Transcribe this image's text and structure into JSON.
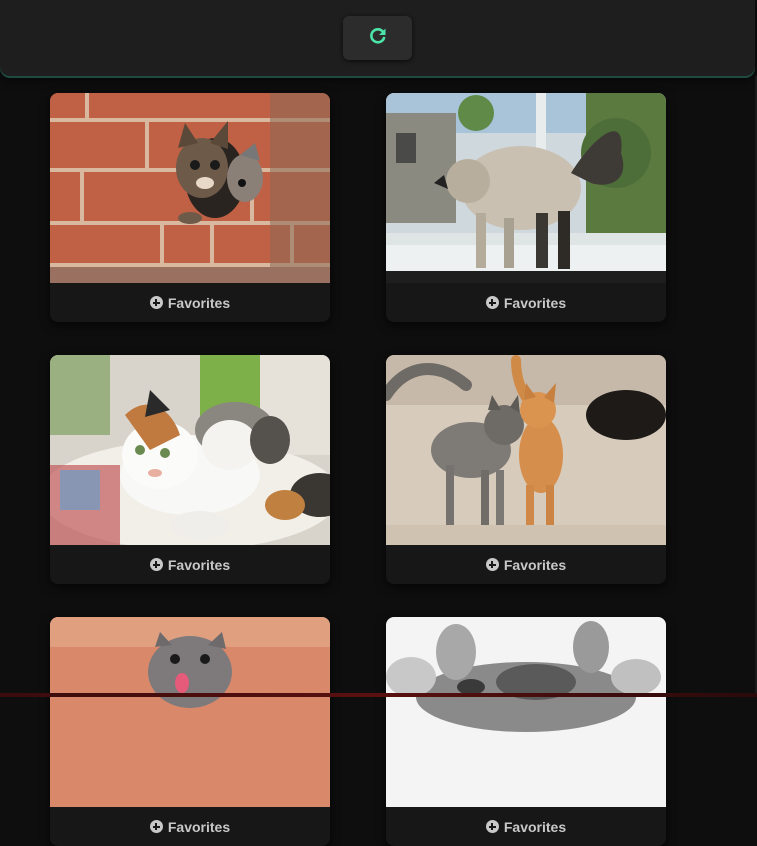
{
  "header": {
    "refresh_icon": "refresh-icon"
  },
  "accent_color": "#4be3a8",
  "cards": [
    {
      "favorite_label": "Favorites",
      "image": "kittens peeking from brick wall"
    },
    {
      "favorite_label": "Favorites",
      "image": "fluffy cat arching at window"
    },
    {
      "favorite_label": "Favorites",
      "image": "calico cat with kittens in basket"
    },
    {
      "favorite_label": "Favorites",
      "image": "grey and orange cats walking together"
    },
    {
      "favorite_label": "Favorites",
      "image": "grey kitten with tongue out"
    },
    {
      "favorite_label": "Favorites",
      "image": "kitten lying on back with paws up"
    }
  ]
}
